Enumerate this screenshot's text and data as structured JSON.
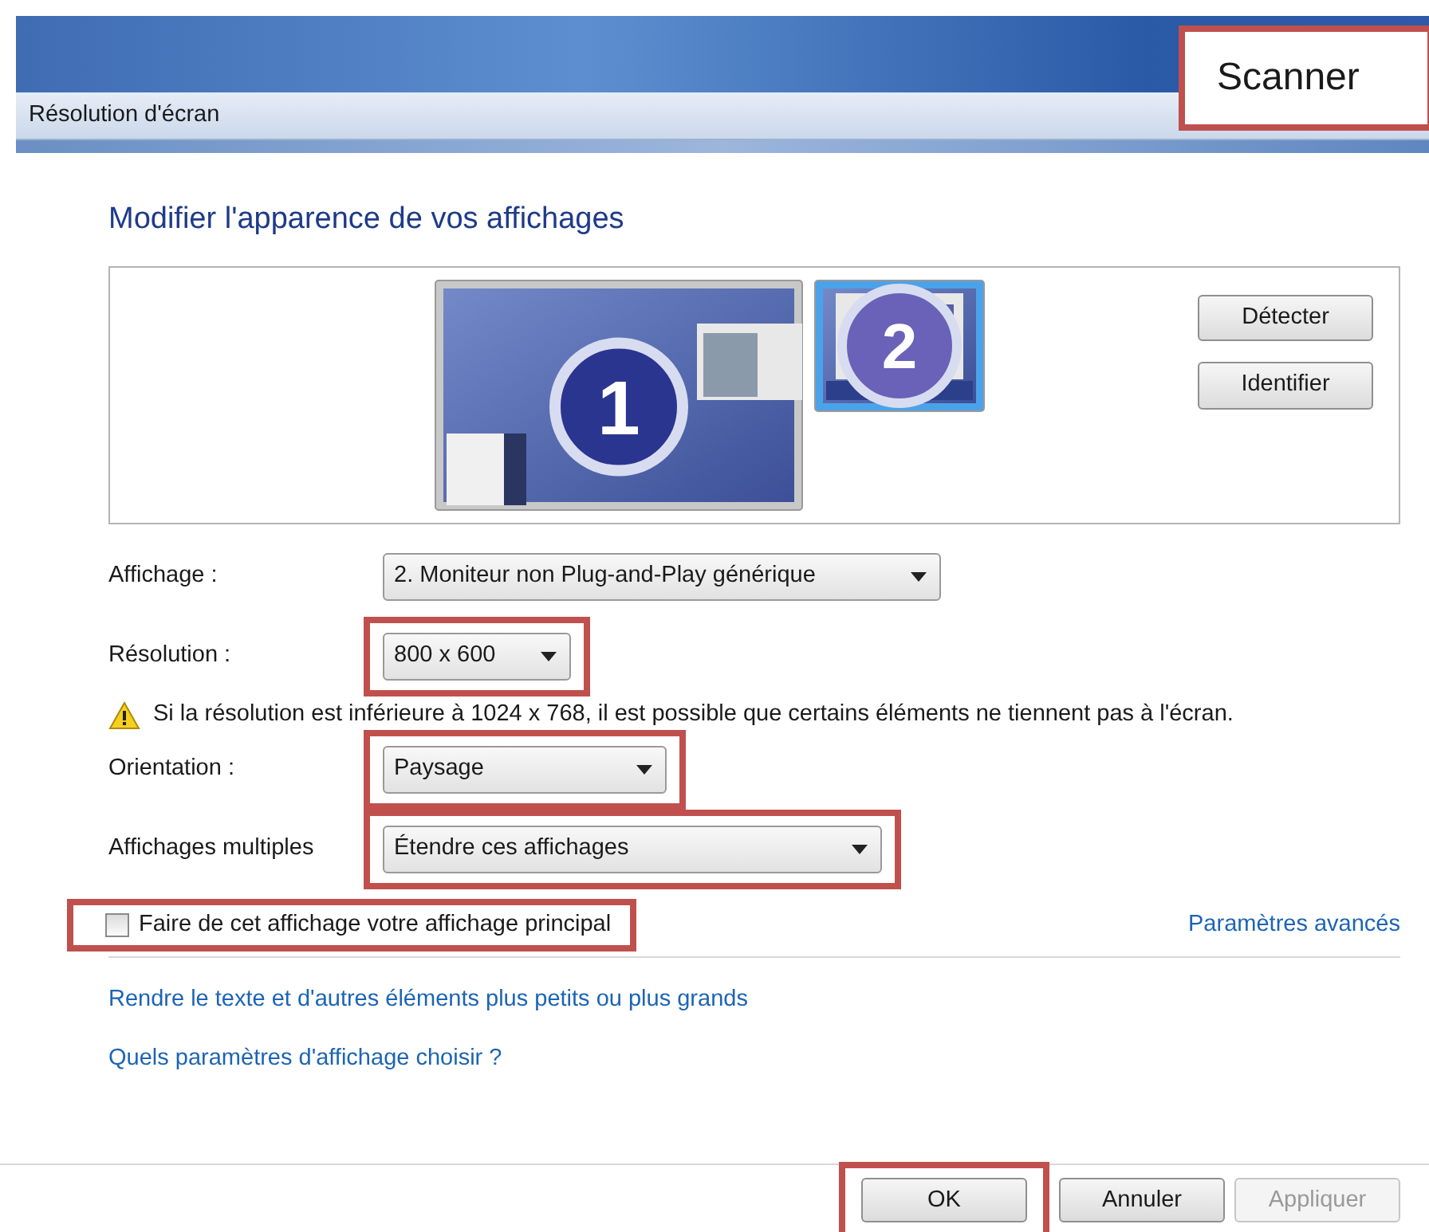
{
  "window": {
    "title": "Résolution d'écran"
  },
  "callout": {
    "text": "Scanner"
  },
  "heading": "Modifier l'apparence de vos affichages",
  "monitors": [
    {
      "number": "1",
      "selected": false
    },
    {
      "number": "2",
      "selected": true
    }
  ],
  "preview_buttons": [
    "Détecter",
    "Identifier"
  ],
  "fields": [
    {
      "label": "Affichage :",
      "value": "2. Moniteur non Plug-and-Play générique",
      "highlighted": false
    },
    {
      "label": "Résolution :",
      "value": "800 x 600",
      "highlighted": true
    },
    {
      "kind": "warning",
      "text": "Si la résolution est inférieure à 1024 x 768, il est possible que certains éléments ne tiennent pas à l'écran."
    },
    {
      "label": "Orientation :",
      "value": "Paysage",
      "highlighted": true
    },
    {
      "label": "Affichages multiples",
      "value": "Étendre ces affichages",
      "highlighted": true
    }
  ],
  "primary_checkbox": {
    "label": "Faire de cet affichage votre affichage principal",
    "checked": false,
    "highlighted": true
  },
  "advanced_link": "Paramètres avancés",
  "links": [
    "Rendre le texte et d'autres éléments plus petits ou plus grands",
    "Quels paramètres d'affichage choisir ?"
  ],
  "buttons": [
    {
      "label": "OK",
      "disabled": false,
      "highlighted": true
    },
    {
      "label": "Annuler",
      "disabled": false,
      "highlighted": false
    },
    {
      "label": "Appliquer",
      "disabled": true,
      "highlighted": false
    }
  ]
}
